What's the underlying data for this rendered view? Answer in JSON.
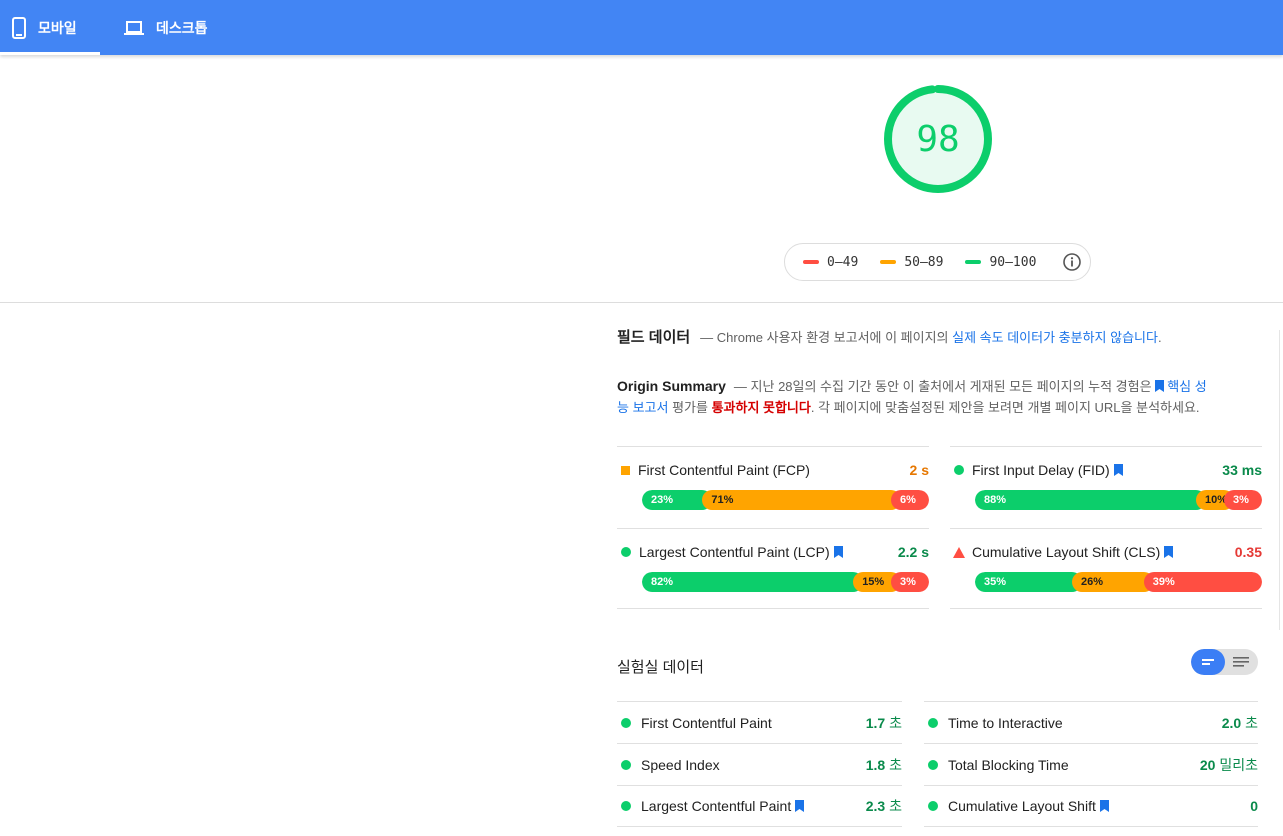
{
  "tabs": {
    "mobile": "모바일",
    "desktop": "데스크톱"
  },
  "score": {
    "value": "98",
    "fraction": 0.98,
    "color": "#0cce6b"
  },
  "legend": {
    "poor": "0–49",
    "average": "50–89",
    "good": "90–100",
    "colors": {
      "poor": "#ff4e42",
      "average": "#ffa400",
      "good": "#0cce6b"
    }
  },
  "field": {
    "title": "필드 데이터",
    "desc_prefix": "— Chrome 사용자 환경 보고서에 이 페이지의 ",
    "desc_link": "실제 속도 데이터가 충분하지 않습니다",
    "desc_suffix": "."
  },
  "origin": {
    "title": "Origin Summary",
    "text1": "— 지난 28일의 수집 기간 동안 이 출처에서 게재된 모든 페이지의 누적 경험은 ",
    "link": "핵심 성능 보고서",
    "text2": " 평가를 ",
    "fail": "통과하지 못합니다",
    "text3": ". 각 페이지에 맞춤설정된 제안을 보려면 개별 페이지 URL을 분석하세요."
  },
  "field_metrics": [
    {
      "name": "First Contentful Paint (FCP)",
      "value": "2 s",
      "status": "average",
      "bookmark": false,
      "dist": [
        "23%",
        "71%",
        "6%"
      ],
      "dist_values": [
        23,
        71,
        6
      ]
    },
    {
      "name": "First Input Delay (FID)",
      "value": "33 ms",
      "status": "good",
      "bookmark": true,
      "dist": [
        "88%",
        "10%",
        "3%"
      ],
      "dist_values": [
        88,
        10,
        3
      ]
    },
    {
      "name": "Largest Contentful Paint (LCP)",
      "value": "2.2 s",
      "status": "good",
      "bookmark": true,
      "dist": [
        "82%",
        "15%",
        "3%"
      ],
      "dist_values": [
        82,
        15,
        3
      ]
    },
    {
      "name": "Cumulative Layout Shift (CLS)",
      "value": "0.35",
      "status": "poor",
      "bookmark": true,
      "dist": [
        "35%",
        "26%",
        "39%"
      ],
      "dist_values": [
        35,
        26,
        39
      ]
    }
  ],
  "lab": {
    "title": "실험실 데이터",
    "metrics": [
      {
        "name": "First Contentful Paint",
        "value": "1.7",
        "unit": " 초",
        "bookmark": false
      },
      {
        "name": "Time to Interactive",
        "value": "2.0",
        "unit": " 초",
        "bookmark": false
      },
      {
        "name": "Speed Index",
        "value": "1.8",
        "unit": " 초",
        "bookmark": false
      },
      {
        "name": "Total Blocking Time",
        "value": "20",
        "unit": " 밀리초",
        "bookmark": false
      },
      {
        "name": "Largest Contentful Paint",
        "value": "2.3",
        "unit": " 초",
        "bookmark": true
      },
      {
        "name": "Cumulative Layout Shift",
        "value": "0",
        "unit": "",
        "bookmark": true
      }
    ]
  }
}
